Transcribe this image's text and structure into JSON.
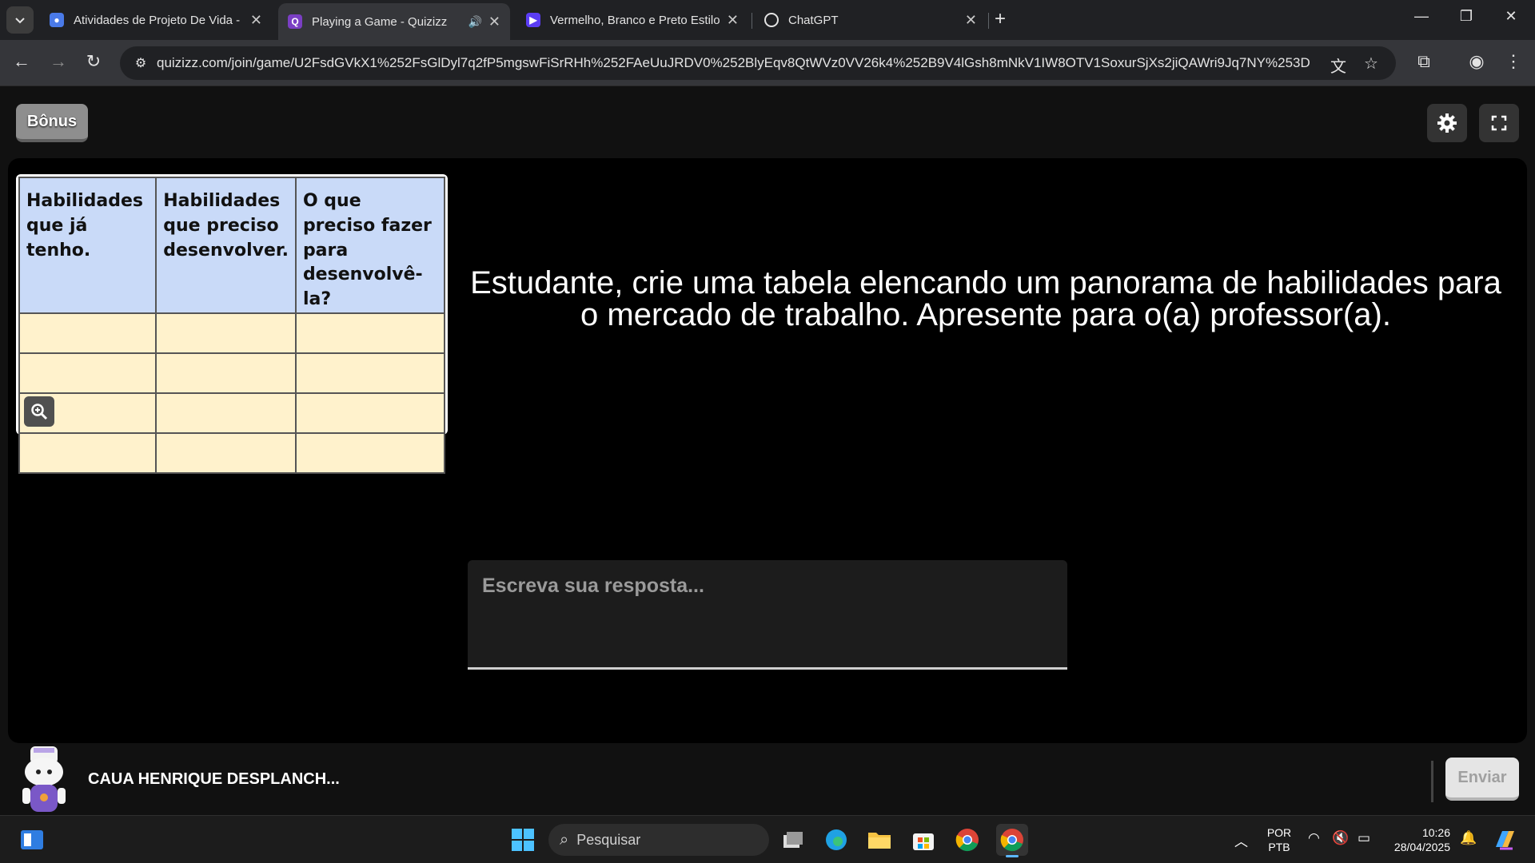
{
  "browser": {
    "tabs": [
      {
        "title": "Atividades de Projeto De Vida -",
        "favicon_color": "#4a7ae8",
        "active": false
      },
      {
        "title": "Playing a Game - Quizizz",
        "favicon_color": "#7b3fc4",
        "active": true
      },
      {
        "title": "Vermelho, Branco e Preto Estilo",
        "favicon_color": "#5b3df5",
        "active": false
      },
      {
        "title": "ChatGPT",
        "favicon_color": "#e3e3e3",
        "active": false
      }
    ],
    "url": "quizizz.com/join/game/U2FsdGVkX1%252FsGlDyl7q2fP5mgswFiSrRHh%252FAeUuJRDV0%252BlyEqv8QtWVz0VV26k4%252B9V4lGsh8mNkV1IW8OTV1SoxurSjXs2jiQAWri9Jq7NY%253D"
  },
  "page": {
    "bonus_label": "Bônus",
    "question_table": {
      "headers": [
        "Habilidades que já tenho.",
        "Habilidades que preciso desenvolver.",
        "O que preciso fazer para desenvolvê-la?"
      ],
      "empty_rows": 4
    },
    "question_text": "Estudante, crie uma tabela elencando um panorama de habilidades para o mercado de trabalho. Apresente para o(a) professor(a).",
    "answer_placeholder": "Escreva sua resposta...",
    "player_name": "CAUA HENRIQUE DESPLANCH...",
    "send_label": "Enviar"
  },
  "taskbar": {
    "search_placeholder": "Pesquisar",
    "lang_top": "POR",
    "lang_bottom": "PTB",
    "time": "10:26",
    "date": "28/04/2025"
  }
}
